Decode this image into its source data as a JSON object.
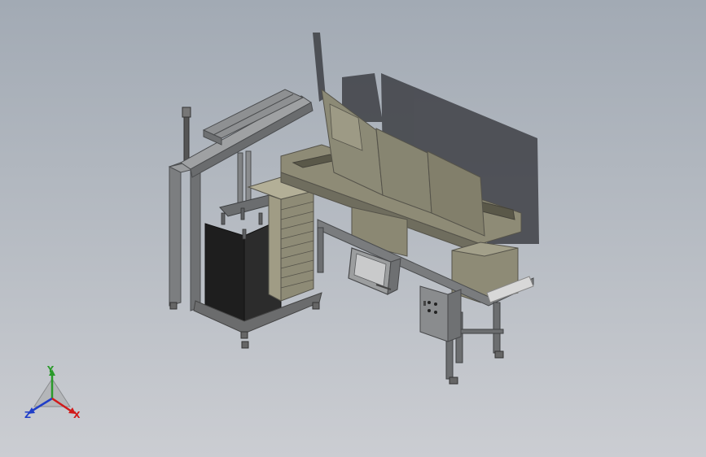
{
  "viewport": {
    "background_top": "#a2aab4",
    "background_bottom": "#cbcdd2"
  },
  "model": {
    "frame_color": "#6e7071",
    "panel_color": "#8d8b78",
    "dark_color": "#222222",
    "shadow_color": "#3e4045"
  },
  "triad": {
    "y_label": "Y",
    "z_label": "Z",
    "x_label": "X",
    "y_color": "#2a9a2a",
    "z_color": "#1f3ec8",
    "x_color": "#d11a1a"
  }
}
